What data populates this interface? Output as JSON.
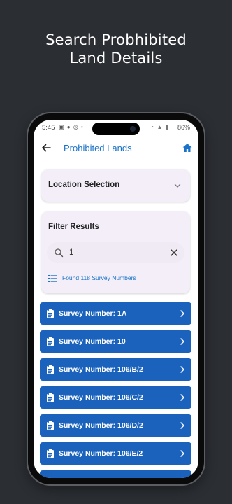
{
  "headline": {
    "line1": "Search Probhibited",
    "line2": "Land Details"
  },
  "status_bar": {
    "time": "5:45",
    "battery": "86%"
  },
  "app_bar": {
    "title": "Prohibited Lands"
  },
  "location_card": {
    "title": "Location Selection"
  },
  "filter_card": {
    "title": "Filter Results",
    "search_value": "1",
    "found_text": "Found 118 Survey Numbers"
  },
  "results": [
    {
      "label": "Survey Number: 1A"
    },
    {
      "label": "Survey Number: 10"
    },
    {
      "label": "Survey Number: 106/B/2"
    },
    {
      "label": "Survey Number: 106/C/2"
    },
    {
      "label": "Survey Number: 106/D/2"
    },
    {
      "label": "Survey Number: 106/E/2"
    }
  ],
  "colors": {
    "accent": "#1a73c8",
    "result_bg": "#1a62bb",
    "card_bg": "#f3eef7",
    "page_bg": "#2b2e33"
  },
  "icons": {
    "back": "arrow-left-icon",
    "home": "home-icon",
    "expand": "chevron-down-icon",
    "search": "search-icon",
    "clear": "close-icon",
    "list": "list-icon",
    "item": "clipboard-icon",
    "item_open": "chevron-right-icon"
  }
}
